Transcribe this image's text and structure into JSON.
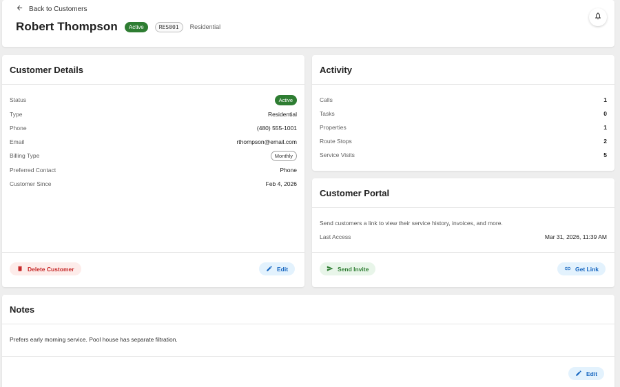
{
  "header": {
    "back_label": "Back to Customers",
    "customer_name": "Robert Thompson",
    "status_badge": "Active",
    "customer_id": "RES001",
    "customer_type": "Residential"
  },
  "details": {
    "title": "Customer Details",
    "rows": [
      {
        "label": "Status",
        "value": "Active"
      },
      {
        "label": "Type",
        "value": "Residential"
      },
      {
        "label": "Phone",
        "value": "(480) 555-1001"
      },
      {
        "label": "Email",
        "value": "rthompson@email.com"
      },
      {
        "label": "Billing Type",
        "value": "Monthly"
      },
      {
        "label": "Preferred Contact",
        "value": "Phone"
      },
      {
        "label": "Customer Since",
        "value": "Feb 4, 2026"
      }
    ],
    "delete_label": "Delete Customer",
    "edit_label": "Edit"
  },
  "activity": {
    "title": "Activity",
    "rows": [
      {
        "label": "Calls",
        "value": "1"
      },
      {
        "label": "Tasks",
        "value": "0"
      },
      {
        "label": "Properties",
        "value": "1"
      },
      {
        "label": "Route Stops",
        "value": "2"
      },
      {
        "label": "Service Visits",
        "value": "5"
      }
    ]
  },
  "portal": {
    "title": "Customer Portal",
    "description": "Send customers a link to view their service history, invoices, and more.",
    "last_access_label": "Last Access",
    "last_access_value": "Mar 31, 2026, 11:39 AM",
    "send_invite_label": "Send Invite",
    "get_link_label": "Get Link"
  },
  "notes": {
    "title": "Notes",
    "text": "Prefers early morning service. Pool house has separate filtration.",
    "edit_label": "Edit"
  },
  "colors": {
    "active_green": "#2e7d32",
    "danger_red": "#c62828",
    "link_blue": "#1565c0"
  },
  "icons": {
    "back": "arrow-left-icon",
    "bell": "bell-icon",
    "delete": "trash-icon",
    "edit": "pencil-icon",
    "send": "send-icon",
    "link": "link-icon"
  }
}
